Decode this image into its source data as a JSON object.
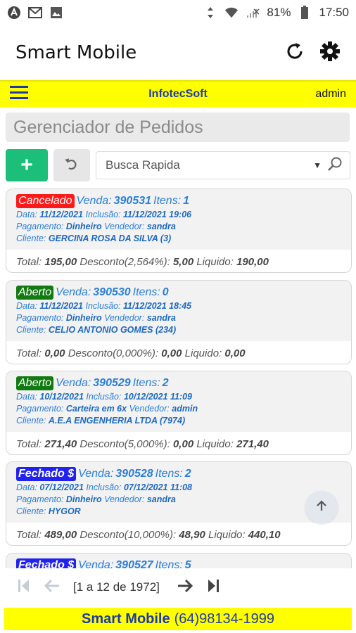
{
  "status_bar": {
    "battery": "81%",
    "time": "17:50"
  },
  "app": {
    "title": "Smart Mobile"
  },
  "header_bar": {
    "company": "InfotecSoft",
    "user": "admin"
  },
  "page": {
    "title": "Gerenciador de Pedidos"
  },
  "toolbar": {
    "add_label": "+",
    "search_placeholder": "Busca Rapida"
  },
  "labels": {
    "venda": "Venda:",
    "itens": "Itens:",
    "data": "Data:",
    "inclusao": "Inclusão:",
    "pagamento": "Pagamento:",
    "vendedor": "Vendedor:",
    "cliente": "Cliente:",
    "total": "Total:",
    "desconto": "Desconto",
    "liquido": "Liquido:"
  },
  "orders": [
    {
      "status": "Cancelado",
      "status_color": "#ff1a1a",
      "venda": "390531",
      "itens": "1",
      "data": "11/12/2021",
      "inclusao": "11/12/2021 19:06",
      "pagamento": "Dinheiro",
      "vendedor": "sandra",
      "cliente": "GERCINA ROSA DA SILVA (3)",
      "total": "195,00",
      "desconto_pct": "(2,564%):",
      "desconto": "5,00",
      "liquido": "190,00"
    },
    {
      "status": "Aberto",
      "status_color": "#117a11",
      "venda": "390530",
      "itens": "0",
      "data": "11/12/2021",
      "inclusao": "11/12/2021 18:45",
      "pagamento": "Dinheiro",
      "vendedor": "sandra",
      "cliente": "CELIO ANTONIO GOMES (234)",
      "total": "0,00",
      "desconto_pct": "(0,000%):",
      "desconto": "0,00",
      "liquido": "0,00"
    },
    {
      "status": "Aberto",
      "status_color": "#117a11",
      "venda": "390529",
      "itens": "2",
      "data": "10/12/2021",
      "inclusao": "10/12/2021 11:09",
      "pagamento": "Carteira em 6x",
      "vendedor": "admin",
      "cliente": "A.E.A ENGENHERIA LTDA (7974)",
      "total": "271,40",
      "desconto_pct": "(5,000%):",
      "desconto": "0,00",
      "liquido": "271,40"
    },
    {
      "status": "Fechado $",
      "status_color": "#2222ee",
      "venda": "390528",
      "itens": "2",
      "data": "07/12/2021",
      "inclusao": "07/12/2021 11:08",
      "pagamento": "Dinheiro",
      "vendedor": "sandra",
      "cliente": "HYGOR",
      "total": "489,00",
      "desconto_pct": "(10,000%):",
      "desconto": "48,90",
      "liquido": "440,10"
    },
    {
      "status": "Fechado $",
      "status_color": "#2222ee",
      "venda": "390527",
      "itens": "5"
    }
  ],
  "pager": {
    "text": "[1 a 12 de 1972]"
  },
  "footer": {
    "brand": "Smart Mobile",
    "phone": "(64)98134-1999"
  }
}
